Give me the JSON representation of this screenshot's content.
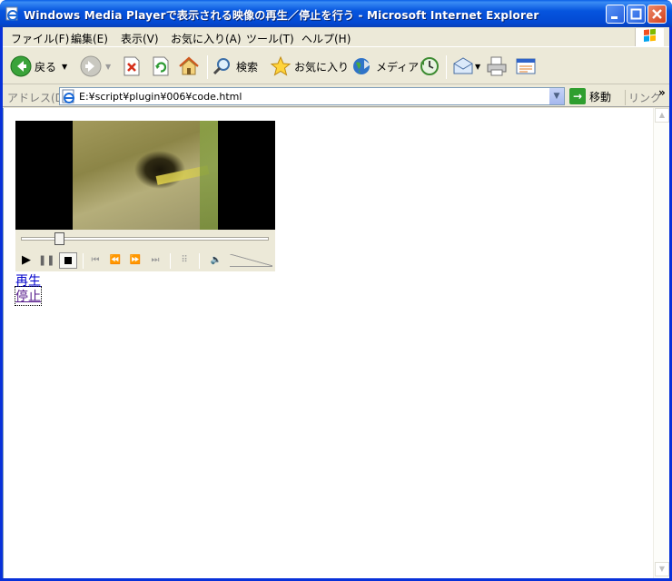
{
  "window": {
    "title": "Windows Media Playerで表示される映像の再生／停止を行う - Microsoft Internet Explorer"
  },
  "menu": {
    "items": [
      "ファイル(F)",
      "編集(E)",
      "表示(V)",
      "お気に入り(A)",
      "ツール(T)",
      "ヘルプ(H)"
    ]
  },
  "toolbar": {
    "back_label": "戻る",
    "search_label": "検索",
    "favorites_label": "お気に入り",
    "media_label": "メディア"
  },
  "address": {
    "label": "アドレス(D)",
    "url": "E:¥script¥plugin¥006¥code.html",
    "go_label": "移動",
    "links_label": "リンク"
  },
  "page": {
    "play_link": "再生",
    "stop_link": "停止"
  },
  "player": {
    "seek_fraction": 0.14
  },
  "colors": {
    "titlebar": "#0655de",
    "link": "#0000cc",
    "visited_link": "#551a8b"
  }
}
